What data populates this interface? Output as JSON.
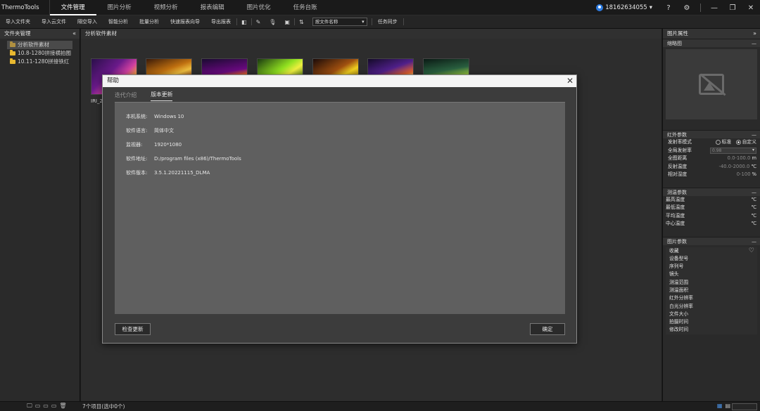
{
  "app": {
    "title": "ThermoTools"
  },
  "nav_tabs": [
    {
      "label": "文件管理",
      "active": true
    },
    {
      "label": "图片分析"
    },
    {
      "label": "视频分析"
    },
    {
      "label": "报表编辑"
    },
    {
      "label": "图片优化"
    },
    {
      "label": "任务台账"
    }
  ],
  "user": {
    "phone": "18162634055"
  },
  "toolbar": {
    "import_file": "导入文件夹",
    "import_cloud": "导入云文件",
    "separate_import": "隔空导入",
    "smart_analysis": "智能分析",
    "batch_analysis": "批量分析",
    "quick_report": "快速报表向导",
    "export_report": "导出报表",
    "sort_select": "按文件名称",
    "task_sync": "任务同步"
  },
  "left_panel": {
    "title": "文件夹管理",
    "items": [
      {
        "label": "分析软件素材",
        "selected": true
      },
      {
        "label": "10.8-1280拼接横拍图"
      },
      {
        "label": "10.11-1280拼接铁红"
      }
    ]
  },
  "main": {
    "title": "分析软件素材",
    "first_thumb_label": "IRI_2"
  },
  "right_panel": {
    "title": "图片属性",
    "thumbnail_section": "缩略图",
    "ir_section": "红外参数",
    "emissivity_mode": "发射率模式",
    "mode_standard": "标准",
    "mode_custom": "自定义",
    "global_emissivity": "全局发射率",
    "emissivity_value": "0.98",
    "global_distance": "全图距离",
    "distance_range": "0.0-100.0",
    "distance_unit": "m",
    "reflect_temp": "反射温度",
    "reflect_range": "-40.0-2000.0",
    "reflect_unit": "℃",
    "humidity": "相对湿度",
    "humidity_range": "0-100",
    "humidity_unit": "%",
    "measure_section": "测温参数",
    "max_temp": "最高温度",
    "min_temp": "最低温度",
    "avg_temp": "平均温度",
    "center_temp": "中心温度",
    "temp_unit": "℃",
    "image_section": "图片参数",
    "image_params": [
      "收藏",
      "设备型号",
      "序列号",
      "镜头",
      "测温范围",
      "测温面积",
      "红外分辨率",
      "白光分辨率",
      "文件大小",
      "拍摄时间",
      "修改时间"
    ]
  },
  "status": {
    "count": "7个项目(选中0个)"
  },
  "dialog": {
    "title": "帮助",
    "tabs": [
      {
        "label": "迭代介绍"
      },
      {
        "label": "版本更新",
        "active": true
      }
    ],
    "rows": [
      {
        "key": "本机系统:",
        "value": "Windows 10"
      },
      {
        "key": "软件语言:",
        "value": "简体中文"
      },
      {
        "key": "监视器:",
        "value": "1920*1080"
      },
      {
        "key": "软件地址:",
        "value": "D:/program files (x86)/ThermoTools"
      },
      {
        "key": "软件版本:",
        "value": "3.5.1.20221115_DLMA"
      }
    ],
    "check_update": "检查更新",
    "confirm": "确定"
  }
}
